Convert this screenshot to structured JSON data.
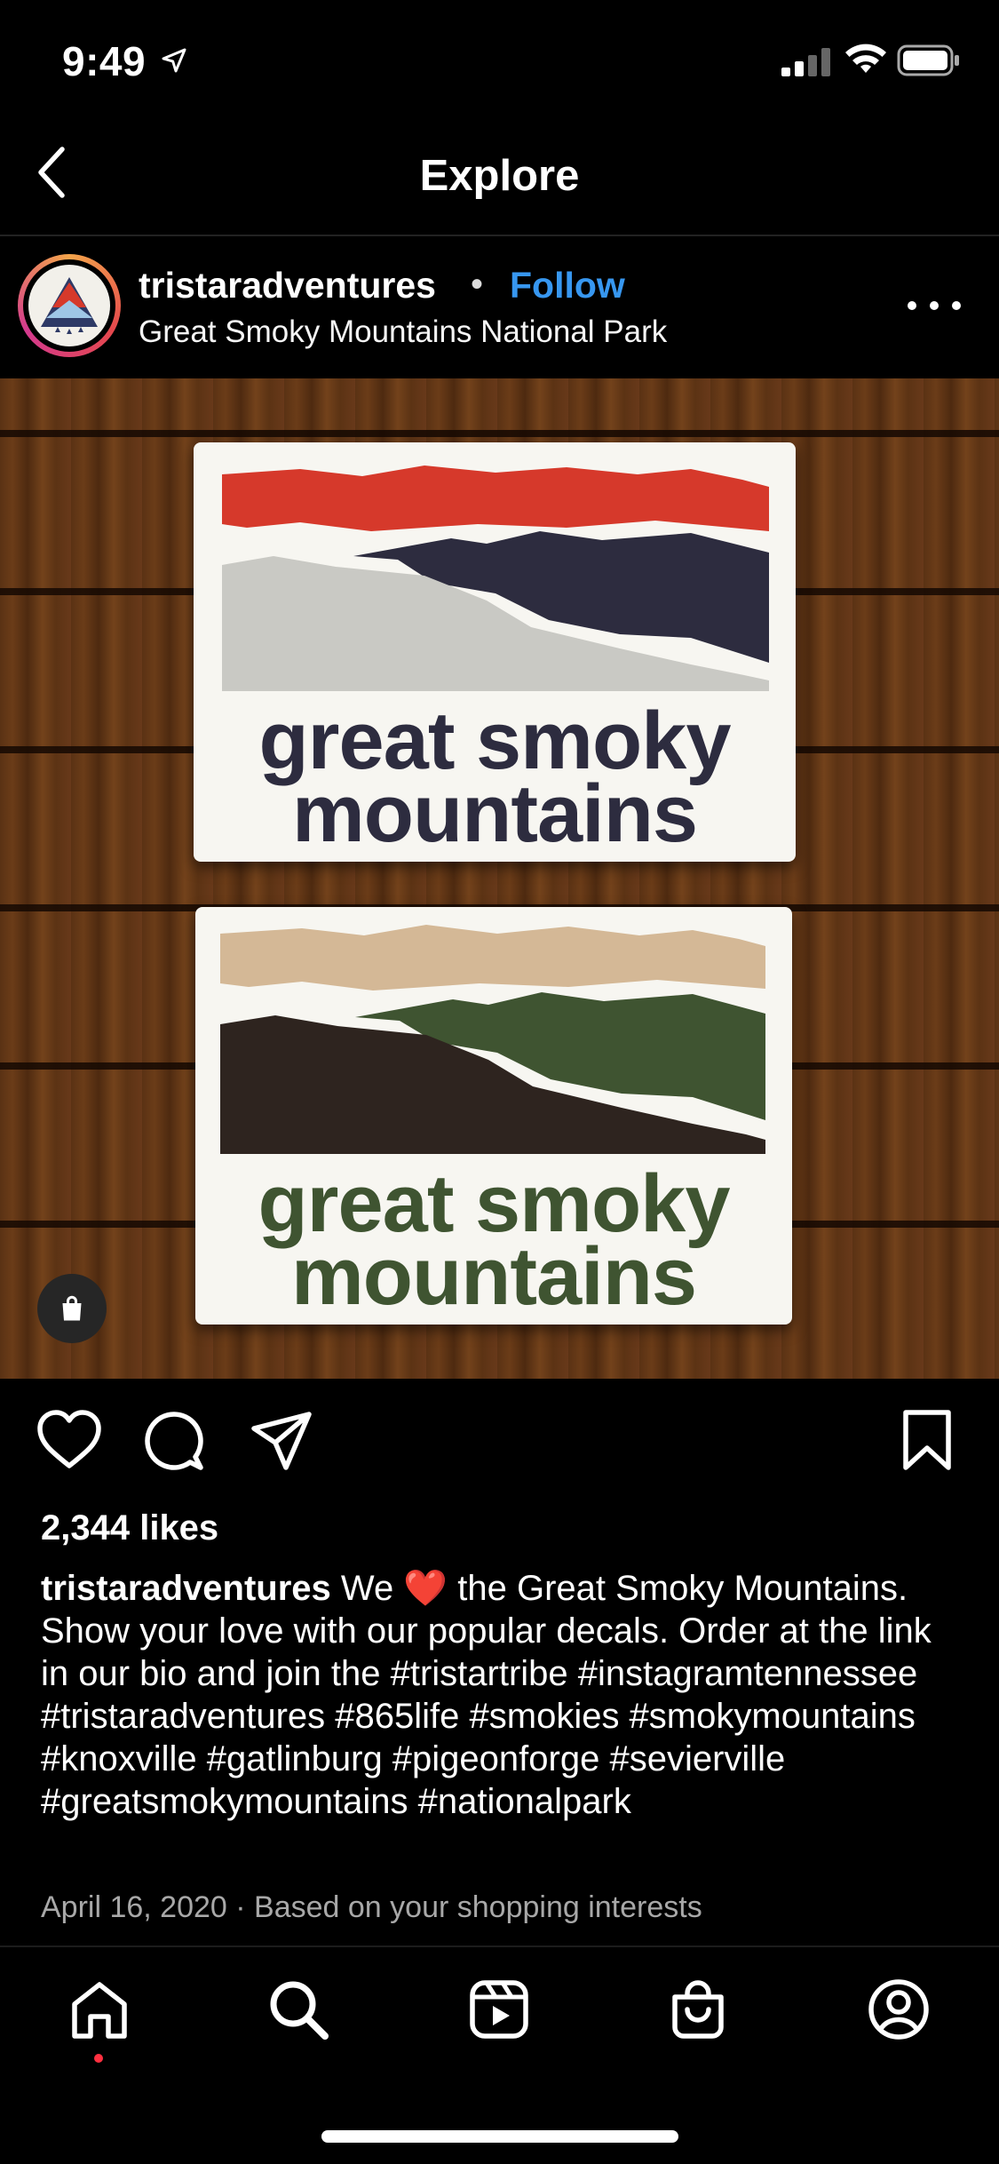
{
  "status_bar": {
    "time": "9:49"
  },
  "header": {
    "title": "Explore"
  },
  "post": {
    "username": "tristaradventures",
    "separator": "•",
    "follow_label": "Follow",
    "location": "Great Smoky Mountains National Park",
    "decal_top": {
      "line1": "great smoky",
      "line2": "mountains",
      "colors": {
        "peak": "#d6392b",
        "ridge": "#2d2c3f",
        "base": "#c9c9c4",
        "text": "#2d2c3f"
      }
    },
    "decal_bottom": {
      "line1": "great smoky",
      "line2": "mountains",
      "colors": {
        "peak": "#d4b896",
        "ridge": "#3f5431",
        "base": "#2e241f",
        "text": "#3f5431"
      }
    },
    "likes": "2,344 likes",
    "caption": {
      "username": "tristaradventures",
      "text_before_heart": " We ",
      "heart": "❤️",
      "text_after_heart": " the Great Smoky Mountains. Show your love with our popular decals. Order at the link in our bio and join the #tristartribe #instagramtennessee #tristaradventures #865life #smokies #smokymountains #knoxville #gatlinburg #pigeonforge #sevierville #greatsmokymountains #nationalpark"
    },
    "date": "April 16, 2020",
    "meta_separator": "·",
    "reason": "Based on your shopping interests"
  },
  "icons": {
    "back": "chevron-left-icon",
    "more": "more-icon",
    "like": "heart-icon",
    "comment": "comment-icon",
    "share": "send-icon",
    "save": "bookmark-icon",
    "shop_tag": "shopping-bag-icon",
    "tabs": [
      "home-icon",
      "search-icon",
      "reels-icon",
      "shop-icon",
      "profile-icon"
    ]
  },
  "colors": {
    "accent": "#3797f0",
    "notification_dot": "#ff3040"
  }
}
